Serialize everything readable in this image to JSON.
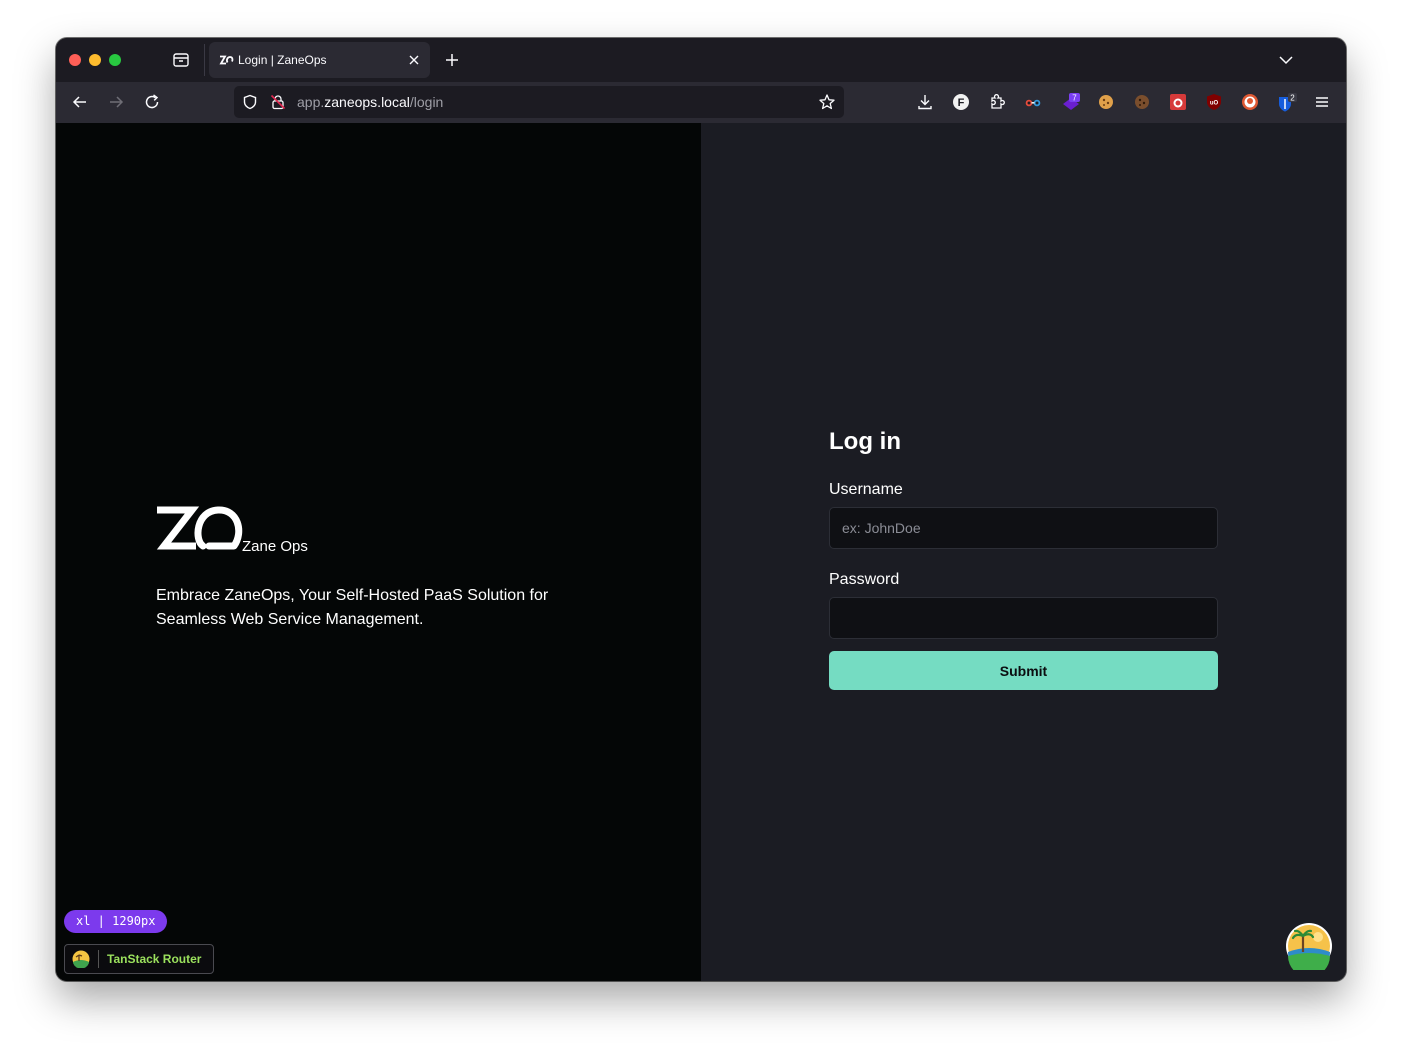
{
  "browser": {
    "tab": {
      "title": "Login | ZaneOps"
    },
    "url": {
      "prefix": "app.",
      "host": "zaneops.local",
      "path": "/login"
    },
    "extensions": [
      {
        "icon": "download-icon"
      },
      {
        "icon": "f-extension-icon",
        "letter": "F"
      },
      {
        "icon": "puzzle-icon"
      },
      {
        "icon": "glasses-extension-icon"
      },
      {
        "icon": "purple-extension-icon",
        "badge": "7"
      },
      {
        "icon": "cookie-icon"
      },
      {
        "icon": "dark-cookie-icon"
      },
      {
        "icon": "red-extension-icon"
      },
      {
        "icon": "ublock-icon",
        "letter": "uO"
      },
      {
        "icon": "duckduckgo-icon"
      },
      {
        "icon": "bitwarden-icon",
        "badge": "2"
      },
      {
        "icon": "menu-icon"
      }
    ]
  },
  "brand": {
    "name": "Zane Ops",
    "tagline": "Embrace ZaneOps, Your Self-Hosted PaaS Solution for Seamless Web Service Management."
  },
  "login": {
    "title": "Log in",
    "username_label": "Username",
    "username_placeholder": "ex: JohnDoe",
    "username_value": "",
    "password_label": "Password",
    "password_value": "",
    "submit_label": "Submit"
  },
  "devtools": {
    "breakpoint": "xl | 1290px",
    "router_label": "TanStack Router"
  },
  "colors": {
    "accent": "#75dcc2",
    "left_bg": "#040606",
    "right_bg": "#1b1c23",
    "badge_purple": "#7c3aed"
  }
}
